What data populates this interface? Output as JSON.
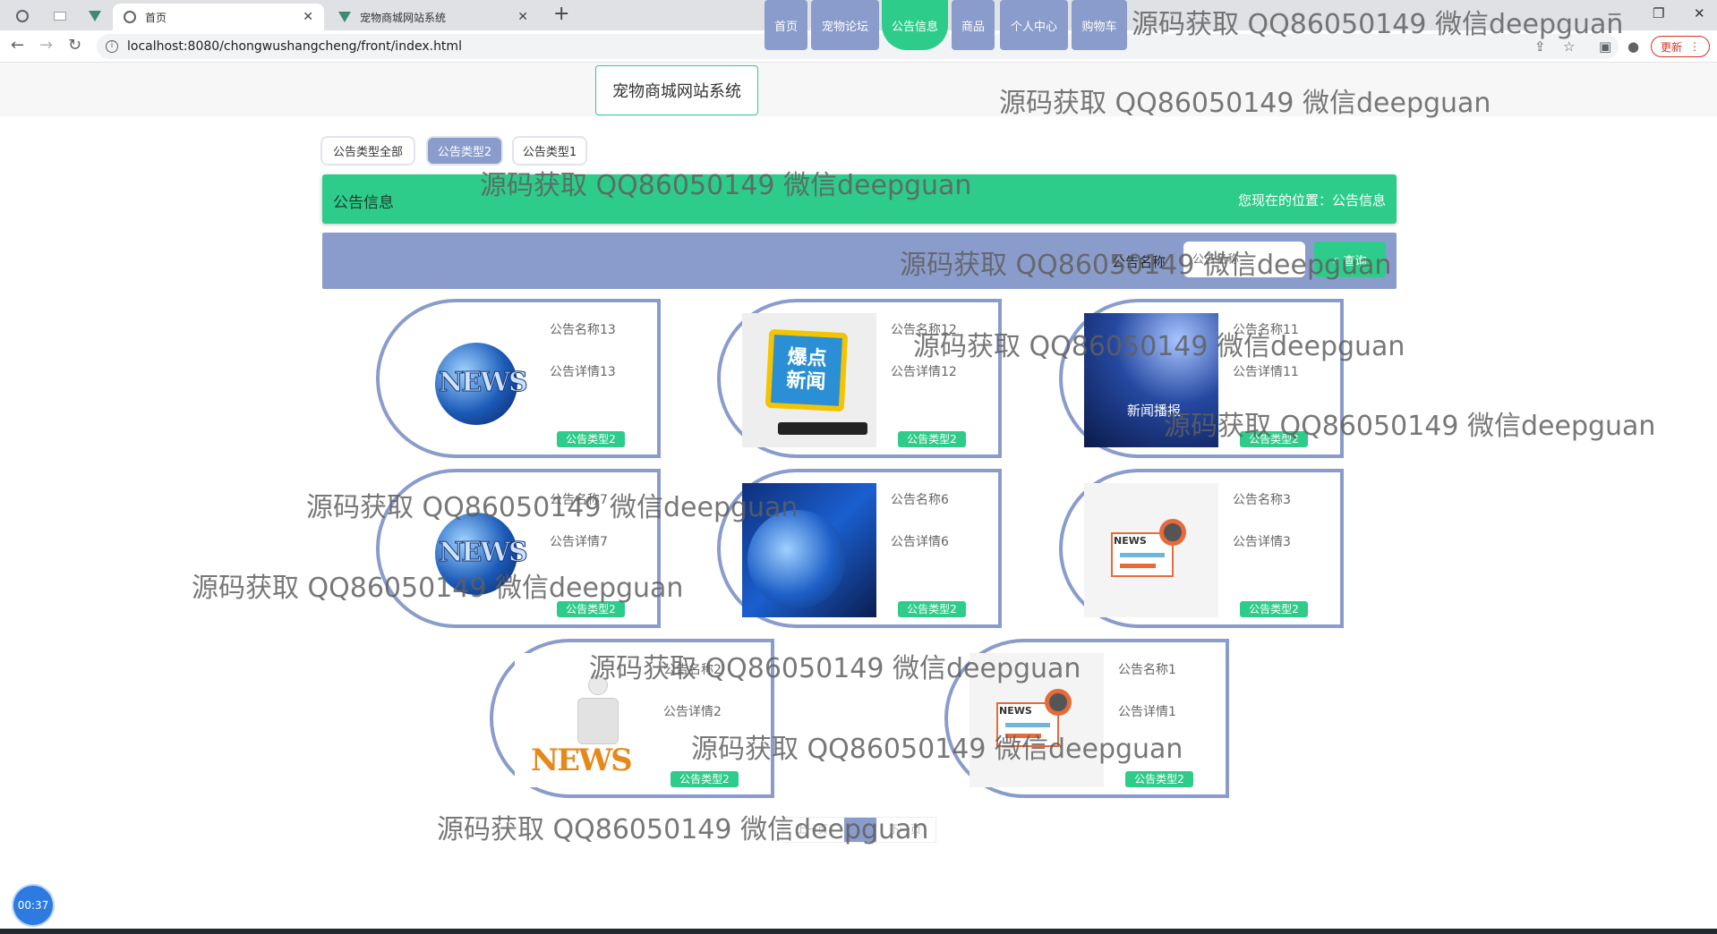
{
  "browser": {
    "tabs": [
      {
        "title": "首页",
        "active": true
      },
      {
        "title": "宠物商城网站系统",
        "active": false
      }
    ],
    "url": "localhost:8080/chongwushangcheng/front/index.html",
    "update_label": "更新"
  },
  "header": {
    "brand": "宠物商城网站系统",
    "nav": [
      "首页",
      "宠物论坛",
      "公告信息",
      "商品",
      "个人中心",
      "购物车"
    ],
    "active_nav": "公告信息"
  },
  "filters": [
    "公告类型全部",
    "公告类型2",
    "公告类型1"
  ],
  "title_bar": {
    "title": "公告信息",
    "breadcrumb": "您现在的位置：公告信息"
  },
  "search": {
    "label": "公告名称",
    "placeholder": "公告名称",
    "button": "查询"
  },
  "cards": [
    {
      "name": "公告名称13",
      "detail": "公告详情13",
      "type": "公告类型2",
      "image": "news-globe"
    },
    {
      "name": "公告名称12",
      "detail": "公告详情12",
      "type": "公告类型2",
      "image": "breaking-news-badge"
    },
    {
      "name": "公告名称11",
      "detail": "公告详情11",
      "type": "公告类型2",
      "image": "news-broadcast-mic",
      "caption": "新闻播报"
    },
    {
      "name": "公告名称7",
      "detail": "公告详情7",
      "type": "公告类型2",
      "image": "news-globe"
    },
    {
      "name": "公告名称6",
      "detail": "公告详情6",
      "type": "公告类型2",
      "image": "news-studio-earth"
    },
    {
      "name": "公告名称3",
      "detail": "公告详情3",
      "type": "公告类型2",
      "image": "newspaper-glasses"
    },
    {
      "name": "公告名称2",
      "detail": "公告详情2",
      "type": "公告类型2",
      "image": "man-reading-news"
    },
    {
      "name": "公告名称1",
      "detail": "公告详情1",
      "type": "公告类型2",
      "image": "newspaper-glasses"
    }
  ],
  "pagination": {
    "prev": "上一页",
    "current": "1",
    "next": "下一页"
  },
  "timer": "00:37",
  "watermark_text": "源码获取 QQ86050149 微信deepguan",
  "colors": {
    "primary_green": "#2ecc8a",
    "lavender": "#8a9ccb",
    "timer_blue": "#2d7be0"
  }
}
